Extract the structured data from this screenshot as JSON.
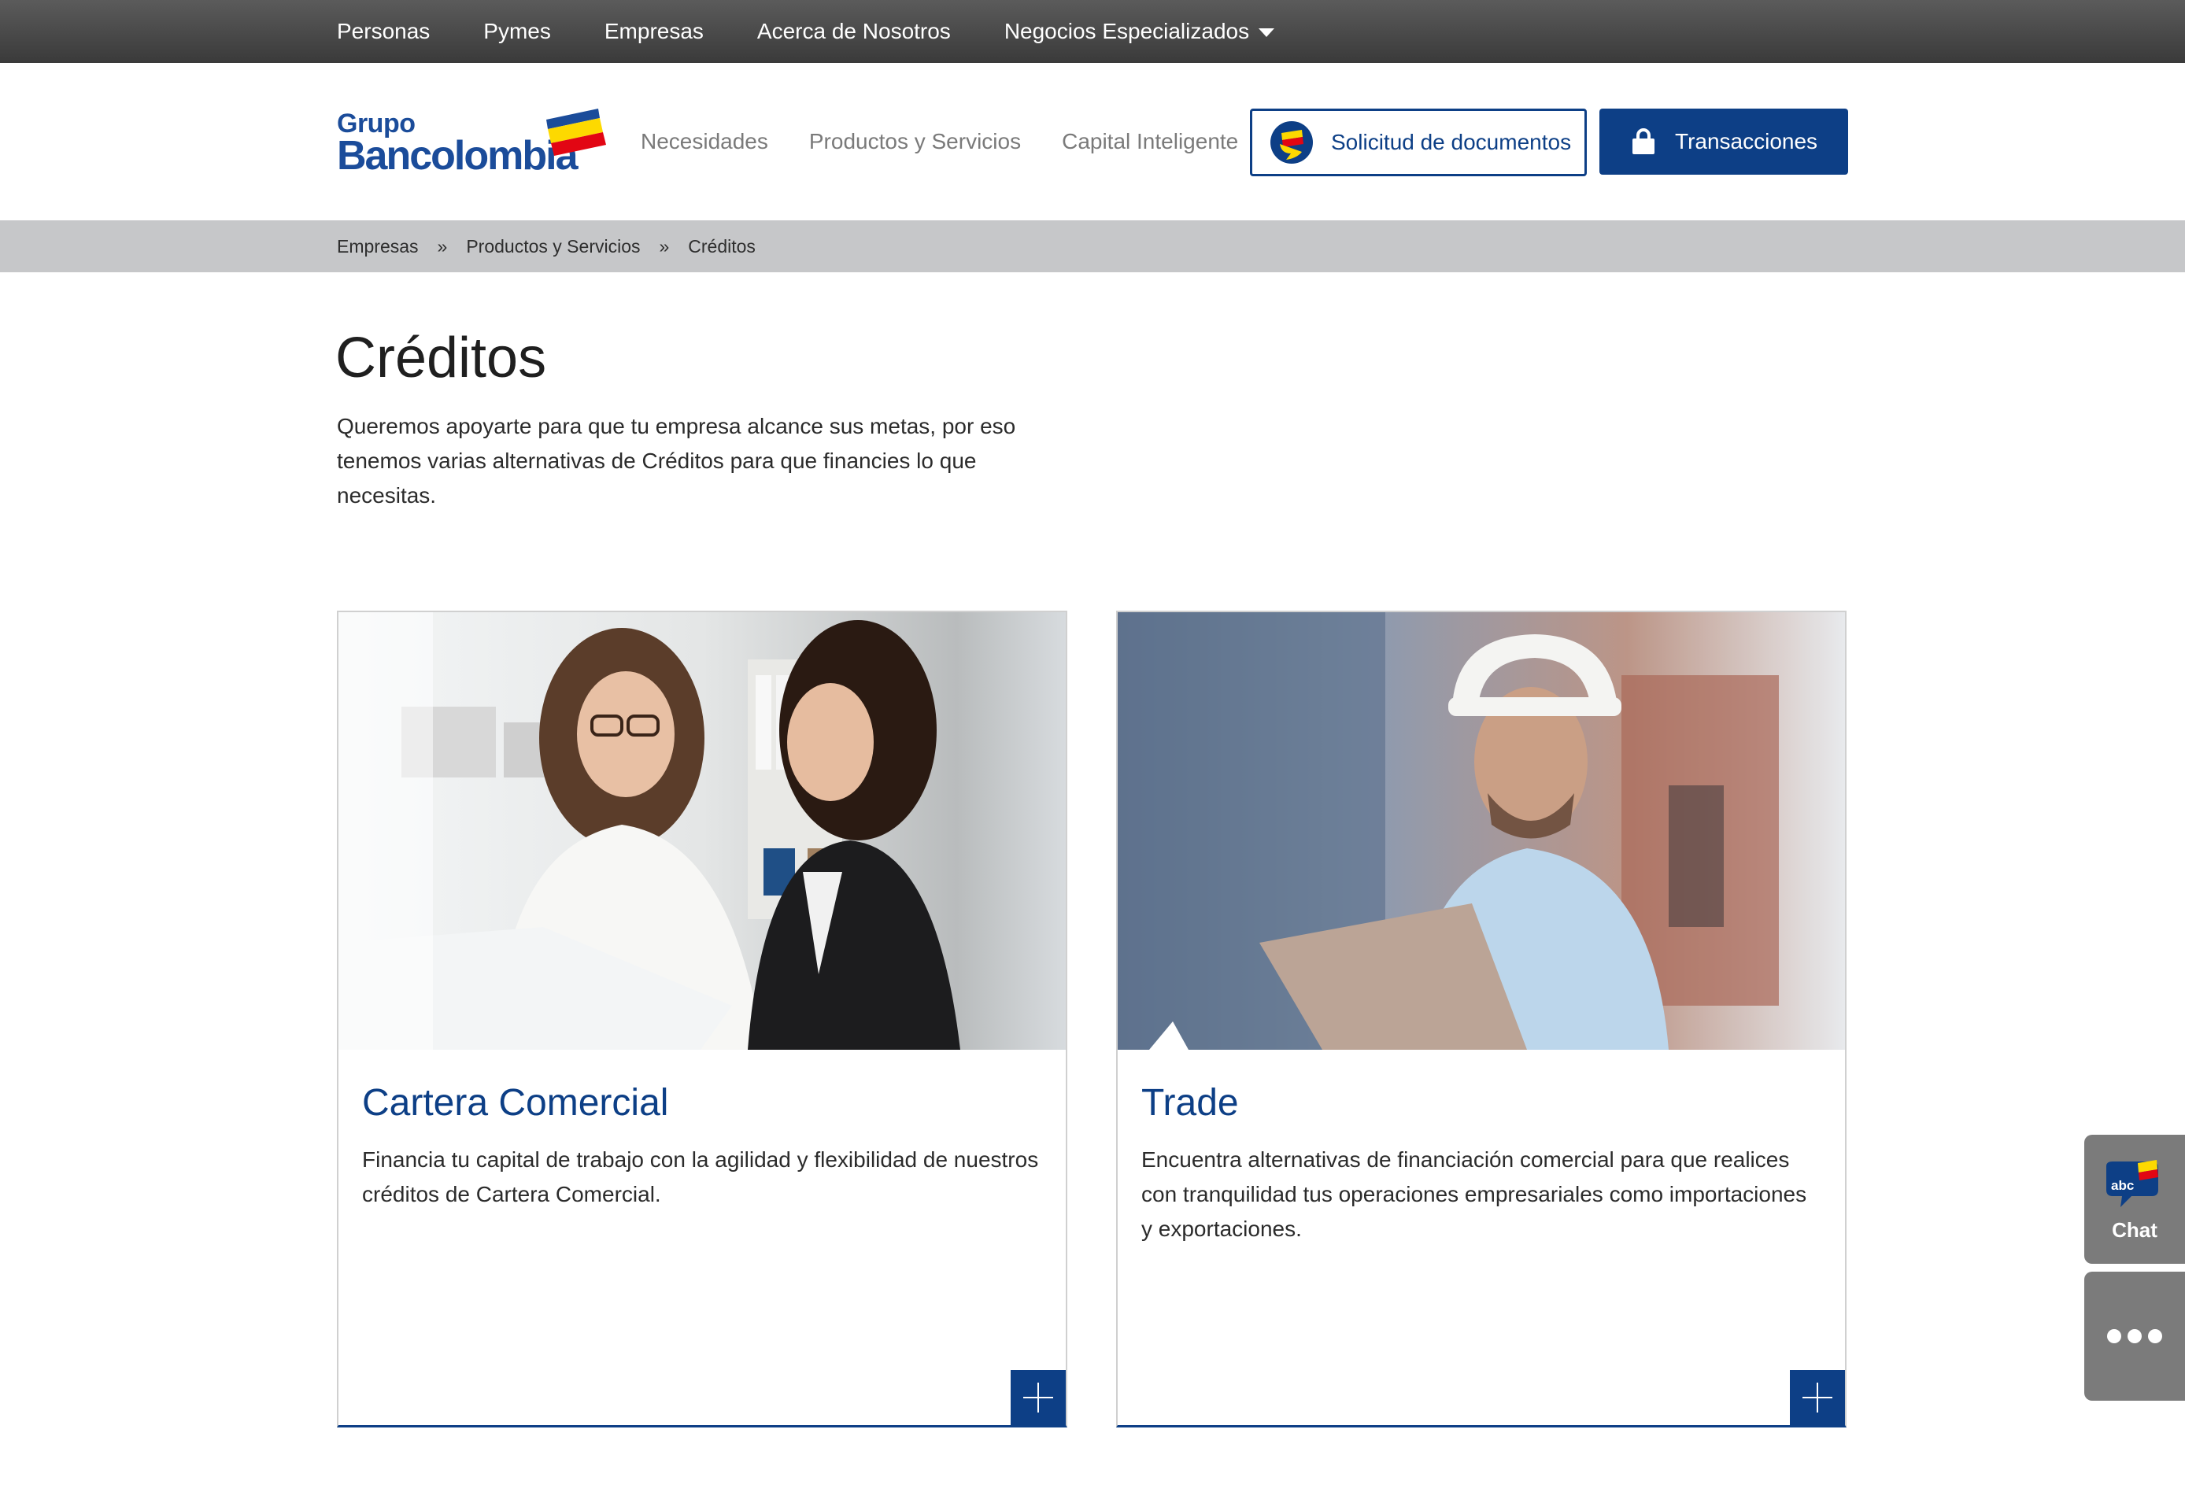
{
  "top_nav": {
    "items": [
      "Personas",
      "Pymes",
      "Empresas",
      "Acerca de Nosotros"
    ],
    "dropdown_label": "Negocios Especializados"
  },
  "logo": {
    "line1": "Grupo",
    "line2": "Bancolombia"
  },
  "main_nav": {
    "items": [
      "Necesidades",
      "Productos y Servicios",
      "Capital Inteligente"
    ]
  },
  "buttons": {
    "docs_label": "Solicitud de documentos",
    "transactions_label": "Transacciones"
  },
  "breadcrumb": {
    "items": [
      "Empresas",
      "Productos y Servicios",
      "Créditos"
    ],
    "separator": "»"
  },
  "page": {
    "title": "Créditos",
    "intro": "Queremos apoyarte para que tu empresa alcance sus metas, por eso tenemos varias alternativas de Créditos para que financies lo que necesitas."
  },
  "cards": [
    {
      "title": "Cartera Comercial",
      "text": "Financia tu capital de trabajo con la agilidad y flexibilidad de nuestros créditos de Cartera Comercial."
    },
    {
      "title": "Trade",
      "text": "Encuentra alternativas de financiación comercial para que realices con tranquilidad tus operaciones empresariales como importaciones y exportaciones."
    }
  ],
  "chat": {
    "badge": "abc",
    "label": "Chat"
  },
  "colors": {
    "brand_blue": "#0d3f86",
    "topbar": "#4a4a4a",
    "breadcrumb_bg": "#c6c7c9",
    "widget_gray": "#7b7b7b",
    "logo_yellow": "#fdd900",
    "logo_red": "#e20613"
  },
  "icons": {
    "dropdown": "caret-down-icon",
    "docs": "document-chat-icon",
    "transactions": "lock-icon",
    "card_action": "plus-icon",
    "more": "ellipsis-icon"
  }
}
